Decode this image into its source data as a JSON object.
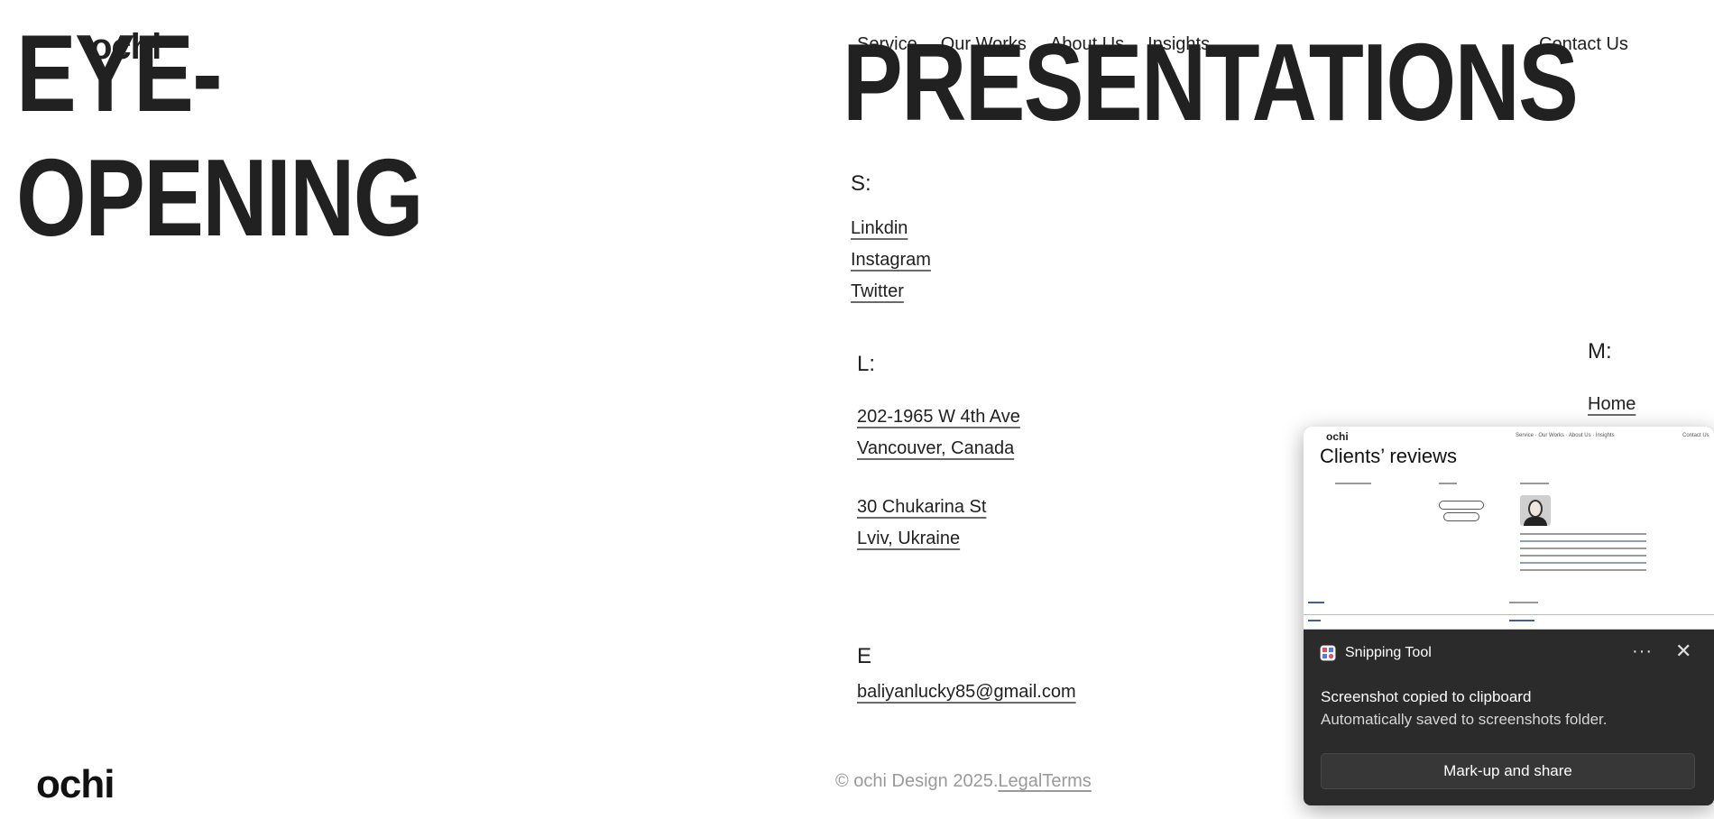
{
  "hero": {
    "line1": "EYE-",
    "line2": "OPENING",
    "line3": "PRESENTATIONS"
  },
  "nav": {
    "logo": "ochi",
    "items": [
      "Service",
      "Our Works",
      "About Us",
      "Insights"
    ],
    "contact": "Contact Us"
  },
  "socials": {
    "label": "S:",
    "links": [
      "Linkdin",
      "Instagram",
      "Twitter"
    ]
  },
  "locations": {
    "label": "L:",
    "address1": [
      "202-1965 W 4th Ave",
      "Vancouver, Canada"
    ],
    "address2": [
      "30 Chukarina St",
      "Lviv, Ukraine"
    ]
  },
  "menu": {
    "label": "M:",
    "links": [
      "Home"
    ]
  },
  "email": {
    "label": "E",
    "value": "baliyanlucky85@gmail.com"
  },
  "footer": {
    "logo": "ochi",
    "copyright": "© ochi Design 2025.",
    "legal": "Legal",
    "terms": "Terms"
  },
  "toast": {
    "app_name": "Snipping Tool",
    "more_icon": "more-icon",
    "close_icon": "close-icon",
    "title": "Screenshot copied to clipboard",
    "body": "Automatically saved to screenshots folder.",
    "button": "Mark-up and share",
    "preview": {
      "logo": "ochi",
      "nav": "Service · Our Works · About Us · Insights",
      "contact": "Contact Us",
      "title": "Clients’ reviews"
    }
  },
  "colors": {
    "text": "#212121",
    "toast_bg": "#2b2b2b",
    "muted": "#9a9a9a"
  }
}
